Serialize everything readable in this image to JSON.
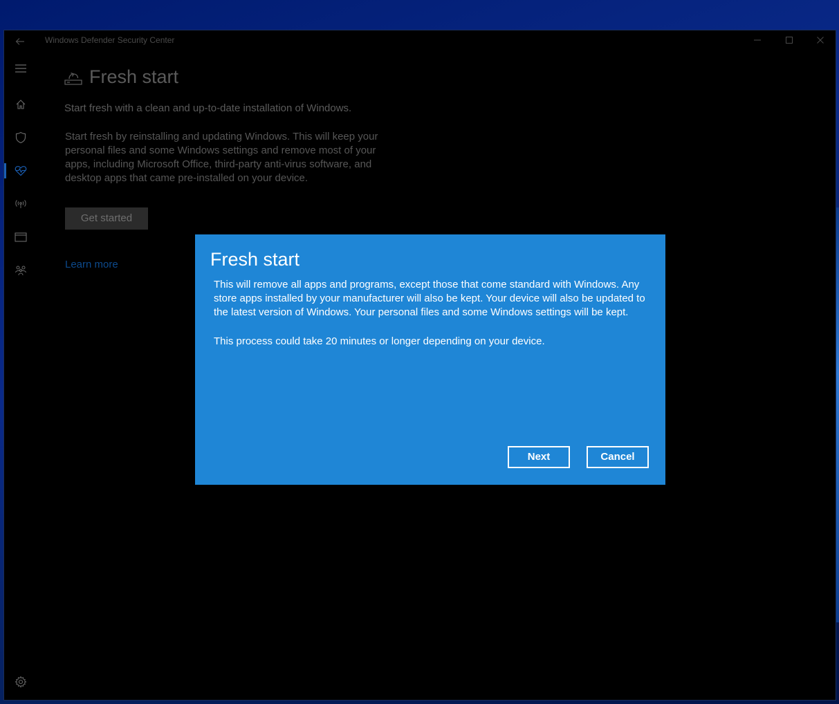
{
  "window": {
    "title": "Windows Defender Security Center",
    "back_icon": "back-arrow-icon",
    "minimize_icon": "minimize-icon",
    "maximize_icon": "maximize-icon",
    "close_icon": "close-icon"
  },
  "nav": {
    "items": [
      {
        "name": "menu",
        "icon": "hamburger-icon"
      },
      {
        "name": "home",
        "icon": "home-icon"
      },
      {
        "name": "virus-protection",
        "icon": "shield-icon"
      },
      {
        "name": "device-performance-health",
        "icon": "heart-pulse-icon",
        "active": true
      },
      {
        "name": "firewall-network",
        "icon": "antenna-icon"
      },
      {
        "name": "app-browser-control",
        "icon": "browser-window-icon"
      },
      {
        "name": "family-options",
        "icon": "family-icon"
      }
    ],
    "settings_icon": "gear-icon",
    "active_color": "#1a5fb4"
  },
  "page": {
    "title": "Fresh start",
    "title_icon": "fresh-start-icon",
    "subtitle": "Start fresh with a clean and up-to-date installation of Windows.",
    "description": "Start fresh by reinstalling and updating Windows. This will keep your personal files and some Windows settings and remove most of your apps, including Microsoft Office, third-party anti-virus software, and desktop apps that came pre-installed on your device.",
    "get_started_label": "Get started",
    "learn_more_label": "Learn more"
  },
  "dialog": {
    "title": "Fresh start",
    "body_1": "This will remove all apps and programs, except those that come standard with Windows. Any store apps installed by your manufacturer will also be kept. Your device will also be updated to the latest version of Windows. Your personal files and some Windows settings will be kept.",
    "body_2": "This process could take 20 minutes or longer depending on your device.",
    "next_label": "Next",
    "cancel_label": "Cancel",
    "background_color": "#1f86d6"
  }
}
